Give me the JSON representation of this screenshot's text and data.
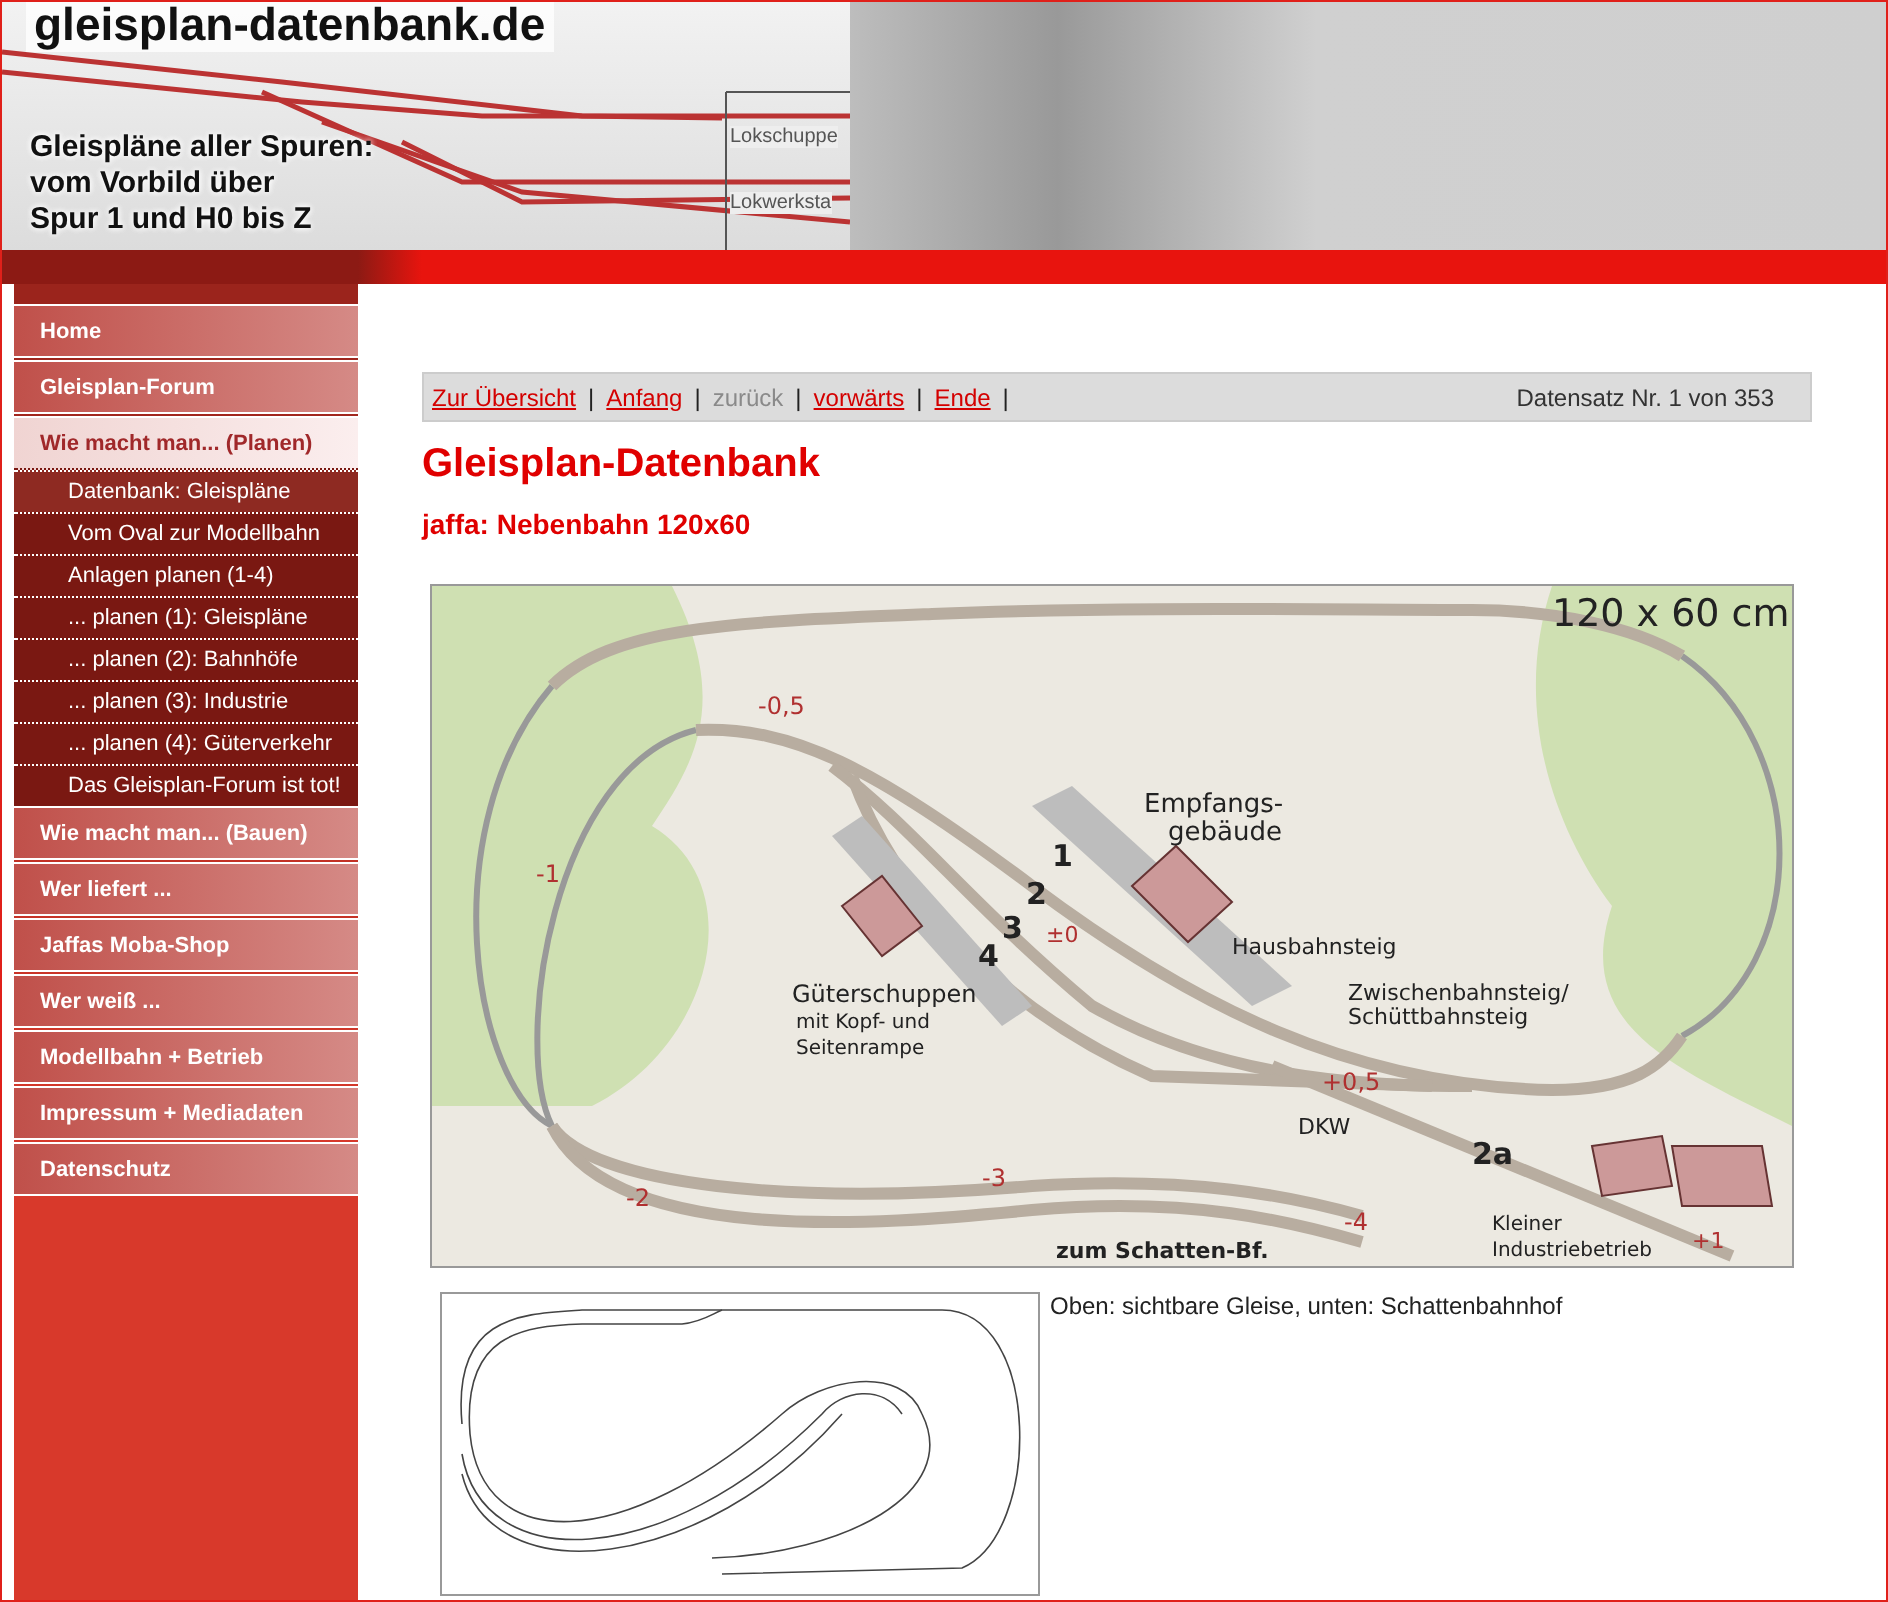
{
  "banner": {
    "site_title": "gleisplan-datenbank.de",
    "tagline": [
      "Gleispläne aller Spuren:",
      "vom Vorbild über",
      "Spur 1 und H0 bis Z"
    ],
    "drawing_labels": [
      "Lokschuppe",
      "Lokwerksta"
    ]
  },
  "sidebar": {
    "items": [
      {
        "label": "Home",
        "selected": false
      },
      {
        "label": "Gleisplan-Forum",
        "selected": false
      },
      {
        "label": "Wie macht man... (Planen)",
        "selected": true,
        "expanded": true,
        "children": [
          {
            "label": "Datenbank: Gleispläne",
            "selected": true
          },
          {
            "label": "Vom Oval zur Modellbahn",
            "selected": false
          },
          {
            "label": "Anlagen planen (1-4)",
            "selected": false
          },
          {
            "label": "... planen (1): Gleispläne",
            "selected": false
          },
          {
            "label": "... planen (2): Bahnhöfe",
            "selected": false
          },
          {
            "label": "... planen (3): Industrie",
            "selected": false
          },
          {
            "label": "... planen (4): Güterverkehr",
            "selected": false
          },
          {
            "label": "Das Gleisplan-Forum ist tot!",
            "selected": false
          }
        ]
      },
      {
        "label": "Wie macht man... (Bauen)",
        "selected": false
      },
      {
        "label": "Wer liefert ...",
        "selected": false
      },
      {
        "label": "Jaffas Moba-Shop",
        "selected": false
      },
      {
        "label": "Wer weiß ...",
        "selected": false
      },
      {
        "label": "Modellbahn + Betrieb",
        "selected": false
      },
      {
        "label": "Impressum + Mediadaten",
        "selected": false
      },
      {
        "label": "Datenschutz",
        "selected": false
      }
    ]
  },
  "record_nav": {
    "separator": "|",
    "items": [
      {
        "label": "Zur Übersicht",
        "disabled": false
      },
      {
        "label": "Anfang",
        "disabled": false
      },
      {
        "label": "zurück",
        "disabled": true
      },
      {
        "label": "vorwärts",
        "disabled": false
      },
      {
        "label": "Ende",
        "disabled": false
      }
    ],
    "record_count": "Datensatz Nr. 1 von 353"
  },
  "title": "Gleisplan-Datenbank",
  "subtitle": "jaffa: Nebenbahn 120x60",
  "plan": {
    "labels": [
      "120 x 60 cm",
      "-0,5",
      "-1",
      "Empfangs-",
      "gebäude",
      "1",
      "2",
      "3",
      "4",
      "±0",
      "Hausbahnsteig",
      "Güterschuppen",
      "mit Kopf- und",
      "Seitenrampe",
      "Zwischenbahnsteig/",
      "Schüttbahnsteig",
      "+0,5",
      "DKW",
      "2a",
      "-2",
      "-3",
      "-4",
      "zum Schatten-Bf.",
      "Kleiner",
      "Industriebetrieb",
      "+1"
    ]
  },
  "caption": "Oben: sichtbare Gleise, unten: Schattenbahnhof"
}
